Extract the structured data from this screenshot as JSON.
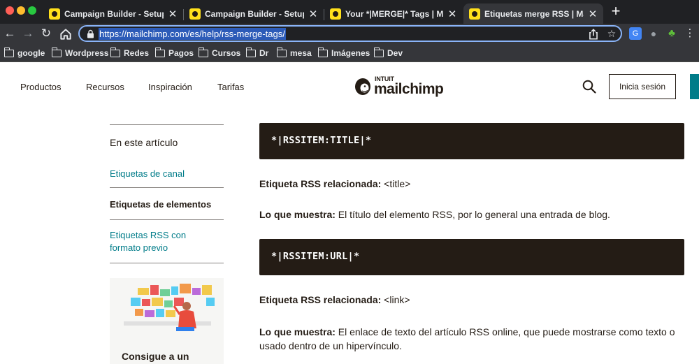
{
  "browser": {
    "tabs": [
      {
        "title": "Campaign Builder - Setup | Ma"
      },
      {
        "title": "Campaign Builder - Setup | Ma"
      },
      {
        "title": "Your *|MERGE|* Tags | Mailchim"
      },
      {
        "title": "Etiquetas merge RSS | Mailchim"
      }
    ],
    "url": "https://mailchimp.com/es/help/rss-merge-tags/",
    "bookmarks": [
      {
        "label": "google"
      },
      {
        "label": "Wordpress"
      },
      {
        "label": "Redes"
      },
      {
        "label": "Pagos"
      },
      {
        "label": "Cursos"
      },
      {
        "label": "Dr"
      },
      {
        "label": "mesa"
      },
      {
        "label": "Imágenes"
      },
      {
        "label": "Dev"
      }
    ]
  },
  "site": {
    "nav": [
      {
        "label": "Productos"
      },
      {
        "label": "Recursos"
      },
      {
        "label": "Inspiración"
      },
      {
        "label": "Tarifas"
      }
    ],
    "logo_small": "INTUIT",
    "logo_word": "mailchimp",
    "login_label": "Inicia sesión"
  },
  "toc": {
    "title": "En este artículo",
    "items": [
      {
        "label": "Etiquetas de canal"
      },
      {
        "label": "Etiquetas de elementos"
      },
      {
        "label": "Etiquetas RSS con formato previo"
      }
    ],
    "promo_title": "Consigue a un"
  },
  "article": {
    "blocks": [
      {
        "code": "*|RSSITEM:TITLE|*",
        "related_label": "Etiqueta RSS relacionada:",
        "related_value": "<title>",
        "shows_label": "Lo que muestra:",
        "shows_value": "El título del elemento RSS, por lo general una entrada de blog."
      },
      {
        "code": "*|RSSITEM:URL|*",
        "related_label": "Etiqueta RSS relacionada:",
        "related_value": "<link>",
        "shows_label": "Lo que muestra:",
        "shows_value": "El enlace de texto del artículo RSS online, que puede mostrarse como texto o usado dentro de un hipervínculo."
      }
    ]
  },
  "colors": {
    "mailchimp_yellow": "#ffe01b",
    "cavendish": "#241c15",
    "peppercorn_teal": "#007c89",
    "chrome_dark": "#202124",
    "chrome_toolbar": "#35363a",
    "focus_ring": "#8ab4f8"
  },
  "icons": {
    "back": "arrow-left-icon",
    "forward": "arrow-right-icon",
    "reload": "reload-icon",
    "home": "home-icon",
    "lock": "lock-icon",
    "share": "share-icon",
    "star": "star-icon",
    "search": "search-icon",
    "folder": "folder-icon",
    "close": "close-icon",
    "new_tab": "plus-icon"
  }
}
